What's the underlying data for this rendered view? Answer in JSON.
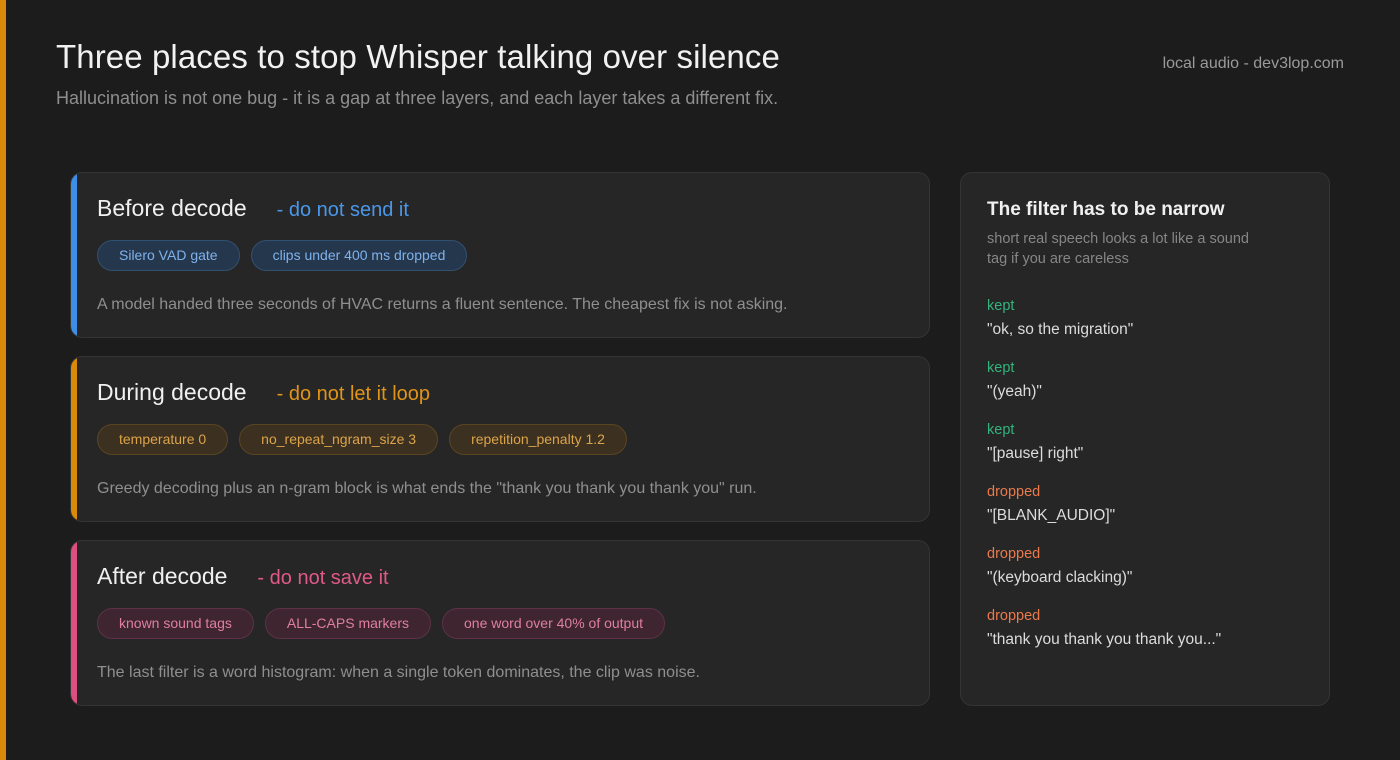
{
  "header": {
    "title": "Three places to stop Whisper talking over silence",
    "subtitle": "Hallucination is not one bug - it is a gap at three layers, and each layer takes a different fix.",
    "source": "local audio - dev3lop.com"
  },
  "colors": {
    "edge_bar": "#d98a0b",
    "before": "#3d8ee6",
    "during": "#d98a0b",
    "after": "#de4f81",
    "kept": "#34b37d",
    "dropped": "#ea7a4c"
  },
  "layers": [
    {
      "name": "Before decode",
      "tag": "- do not send it",
      "chips": [
        "Silero VAD gate",
        "clips under 400 ms dropped"
      ],
      "description": "A model handed three seconds of HVAC returns a fluent sentence. The cheapest fix is not asking."
    },
    {
      "name": "During decode",
      "tag": "- do not let it loop",
      "chips": [
        "temperature 0",
        "no_repeat_ngram_size 3",
        "repetition_penalty 1.2"
      ],
      "description": "Greedy decoding plus an n-gram block is what ends the \"thank you thank you thank you\" run."
    },
    {
      "name": "After decode",
      "tag": "- do not save it",
      "chips": [
        "known sound tags",
        "ALL-CAPS markers",
        "one word over 40% of output"
      ],
      "description": "The last filter is a word histogram: when a single token dominates, the clip was noise."
    }
  ],
  "side": {
    "title": "The filter has to be narrow",
    "note": "short real speech looks a lot like a sound tag if you are careless",
    "examples": [
      {
        "status": "kept",
        "text": "\"ok, so the migration\""
      },
      {
        "status": "kept",
        "text": "\"(yeah)\""
      },
      {
        "status": "kept",
        "text": "\"[pause] right\""
      },
      {
        "status": "dropped",
        "text": "\"[BLANK_AUDIO]\""
      },
      {
        "status": "dropped",
        "text": "\"(keyboard clacking)\""
      },
      {
        "status": "dropped",
        "text": "\"thank you thank you thank you...\""
      }
    ]
  }
}
